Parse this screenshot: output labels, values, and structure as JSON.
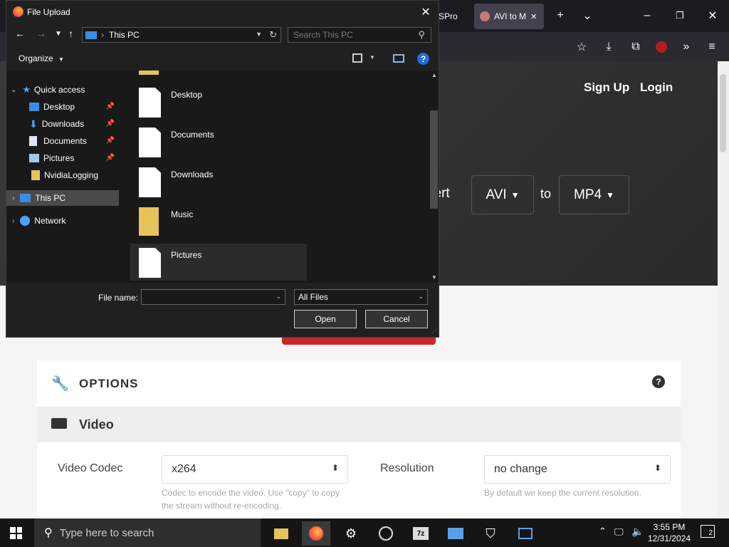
{
  "browser": {
    "tab_partial": "ASPro",
    "tab_active": "AVI to M",
    "tab_close": "✕",
    "new_tab": "+",
    "list_tabs": "⌄",
    "minimize": "–",
    "restore": "❐",
    "close": "✕"
  },
  "site": {
    "signup": "Sign Up",
    "login": "Login",
    "convert_word": "vert",
    "from_format": "AVI",
    "to_word": "to",
    "to_format": "MP4",
    "options_title": "OPTIONS",
    "video_title": "Video",
    "codec_label": "Video Codec",
    "codec_value": "x264",
    "codec_hint": "Codec to encode the video. Use \"copy\" to copy the stream without re-encoding.",
    "res_label": "Resolution",
    "res_value": "no change",
    "res_hint": "By default we keep the current resolution."
  },
  "dialog": {
    "title": "File Upload",
    "address": "This PC",
    "search_placeholder": "Search This PC",
    "organize": "Organize",
    "nav": [
      {
        "label": "Quick access"
      },
      {
        "label": "Desktop"
      },
      {
        "label": "Downloads"
      },
      {
        "label": "Documents"
      },
      {
        "label": "Pictures"
      },
      {
        "label": "NvidiaLogging"
      },
      {
        "label": "This PC"
      },
      {
        "label": "Network"
      }
    ],
    "files": [
      {
        "label": "Desktop"
      },
      {
        "label": "Documents"
      },
      {
        "label": "Downloads"
      },
      {
        "label": "Music"
      },
      {
        "label": "Pictures"
      }
    ],
    "filename_label": "File name:",
    "filename_value": "",
    "filetype": "All Files",
    "open": "Open",
    "cancel": "Cancel"
  },
  "taskbar": {
    "search_placeholder": "Type here to search",
    "time": "3:55 PM",
    "date": "12/31/2024",
    "notif_count": "2",
    "zip_label": "7z"
  },
  "colors": {
    "accent_red": "#c62828",
    "dialog_bg": "#202020",
    "folder_yellow": "#e8c25a"
  }
}
